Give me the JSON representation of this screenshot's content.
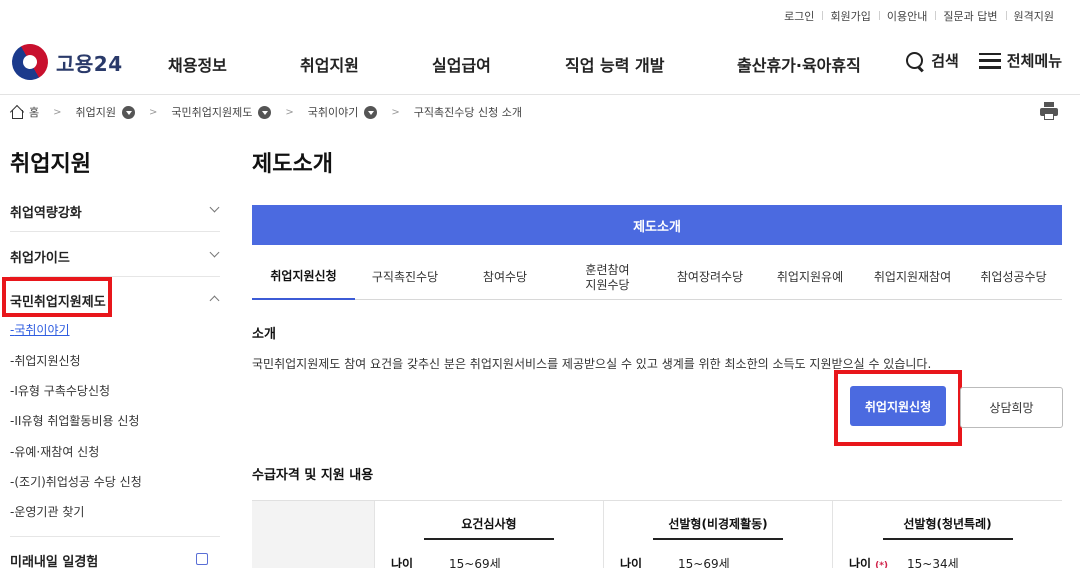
{
  "util_nav": [
    "로그인",
    "회원가입",
    "이용안내",
    "질문과 답변",
    "원격지원"
  ],
  "logo": {
    "text": "고용24"
  },
  "gnb": [
    "채용정보",
    "취업지원",
    "실업급여",
    "직업 능력 개발",
    "출산휴가·육아휴직"
  ],
  "header_tools": {
    "search": "검색",
    "menu": "전체메뉴"
  },
  "breadcrumb": {
    "home": "홈",
    "items": [
      "취업지원",
      "국민취업지원제도",
      "국취이야기"
    ],
    "current": "구직촉진수당 신청 소개"
  },
  "sidebar": {
    "title": "취업지원",
    "sections": [
      "취업역량강화",
      "취업가이드",
      "국민취업지원제도"
    ],
    "sub_items": [
      "국취이야기",
      "취업지원신청",
      "I유형 구촉수당신청",
      "II유형 취업활동비용 신청",
      "유예·재참여 신청",
      "(조기)취업성공 수당 신청",
      "운영기관 찾기"
    ],
    "next_section": "미래내일 일경험"
  },
  "main": {
    "title": "제도소개",
    "tab_bar": "제도소개",
    "sub_tabs": [
      "취업지원신청",
      "구직촉진수당",
      "참여수당",
      "훈련참여\n지원수당",
      "참여장려수당",
      "취업지원유예",
      "취업지원재참여",
      "취업성공수당"
    ],
    "intro_heading": "소개",
    "intro_text": "국민취업지원제도 참여 요건을 갖추신 분은 취업지원서비스를 제공받으실 수 있고 생계를 위한 최소한의 소득도 지원받으실 수 있습니다.",
    "apply_button": "취업지원신청",
    "consult_button": "상담희망",
    "eligibility_heading": "수급자격 및 지원 내용",
    "table": {
      "columns": [
        "요건심사형",
        "선발형(비경제활동)",
        "선발형(청년특례)"
      ],
      "row_label": "나이",
      "row_values": [
        "15~69세",
        "15~69세",
        "15~34세"
      ],
      "note_mark": "(*)"
    }
  }
}
